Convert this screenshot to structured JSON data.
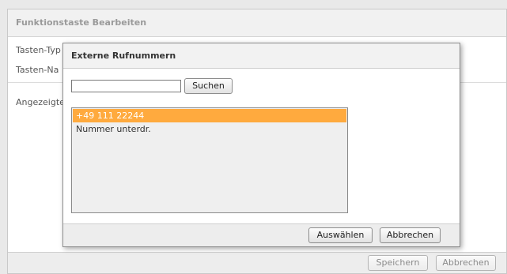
{
  "background_page": {
    "title": "Funktionstaste Bearbeiten",
    "labels": [
      "Tasten-Typ",
      "Tasten-Na",
      "Angezeigte"
    ],
    "footer": {
      "save_label": "Speichern",
      "cancel_label": "Abbrechen"
    }
  },
  "dialog": {
    "title": "Externe Rufnummern",
    "search": {
      "value": "",
      "placeholder": "",
      "button_label": "Suchen"
    },
    "list": {
      "items": [
        {
          "label": "+49 111 22244",
          "selected": true
        },
        {
          "label": "Nummer unterdr.",
          "selected": false
        }
      ]
    },
    "footer": {
      "select_label": "Auswählen",
      "cancel_label": "Abbrechen"
    }
  },
  "colors": {
    "selection": "#ffaa3e"
  }
}
